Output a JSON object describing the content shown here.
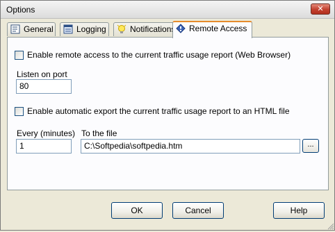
{
  "window": {
    "title": "Options",
    "close_label": "✕"
  },
  "tabs": [
    {
      "label": "General",
      "icon": "general-icon"
    },
    {
      "label": "Logging",
      "icon": "logging-icon"
    },
    {
      "label": "Notifications",
      "icon": "bulb-icon"
    },
    {
      "label": "Remote Access",
      "icon": "diamond-icon",
      "active": true
    }
  ],
  "remote": {
    "enable_label": "Enable remote access to the current traffic usage report (Web Browser)",
    "enable_checked": false,
    "port_label": "Listen on port",
    "port_value": "80"
  },
  "export": {
    "enable_label": "Enable automatic export the current traffic usage report to an HTML file",
    "enable_checked": false,
    "every_label": "Every (minutes)",
    "every_value": "1",
    "file_label": "To the file",
    "file_value": "C:\\Softpedia\\softpedia.htm",
    "browse_label": "..."
  },
  "buttons": {
    "ok": "OK",
    "cancel": "Cancel",
    "help": "Help"
  },
  "colors": {
    "active_tab_accent": "#e68b2c",
    "close_button": "#c2402e",
    "panel": "#fcfcfe",
    "dialog": "#ece9d8"
  }
}
